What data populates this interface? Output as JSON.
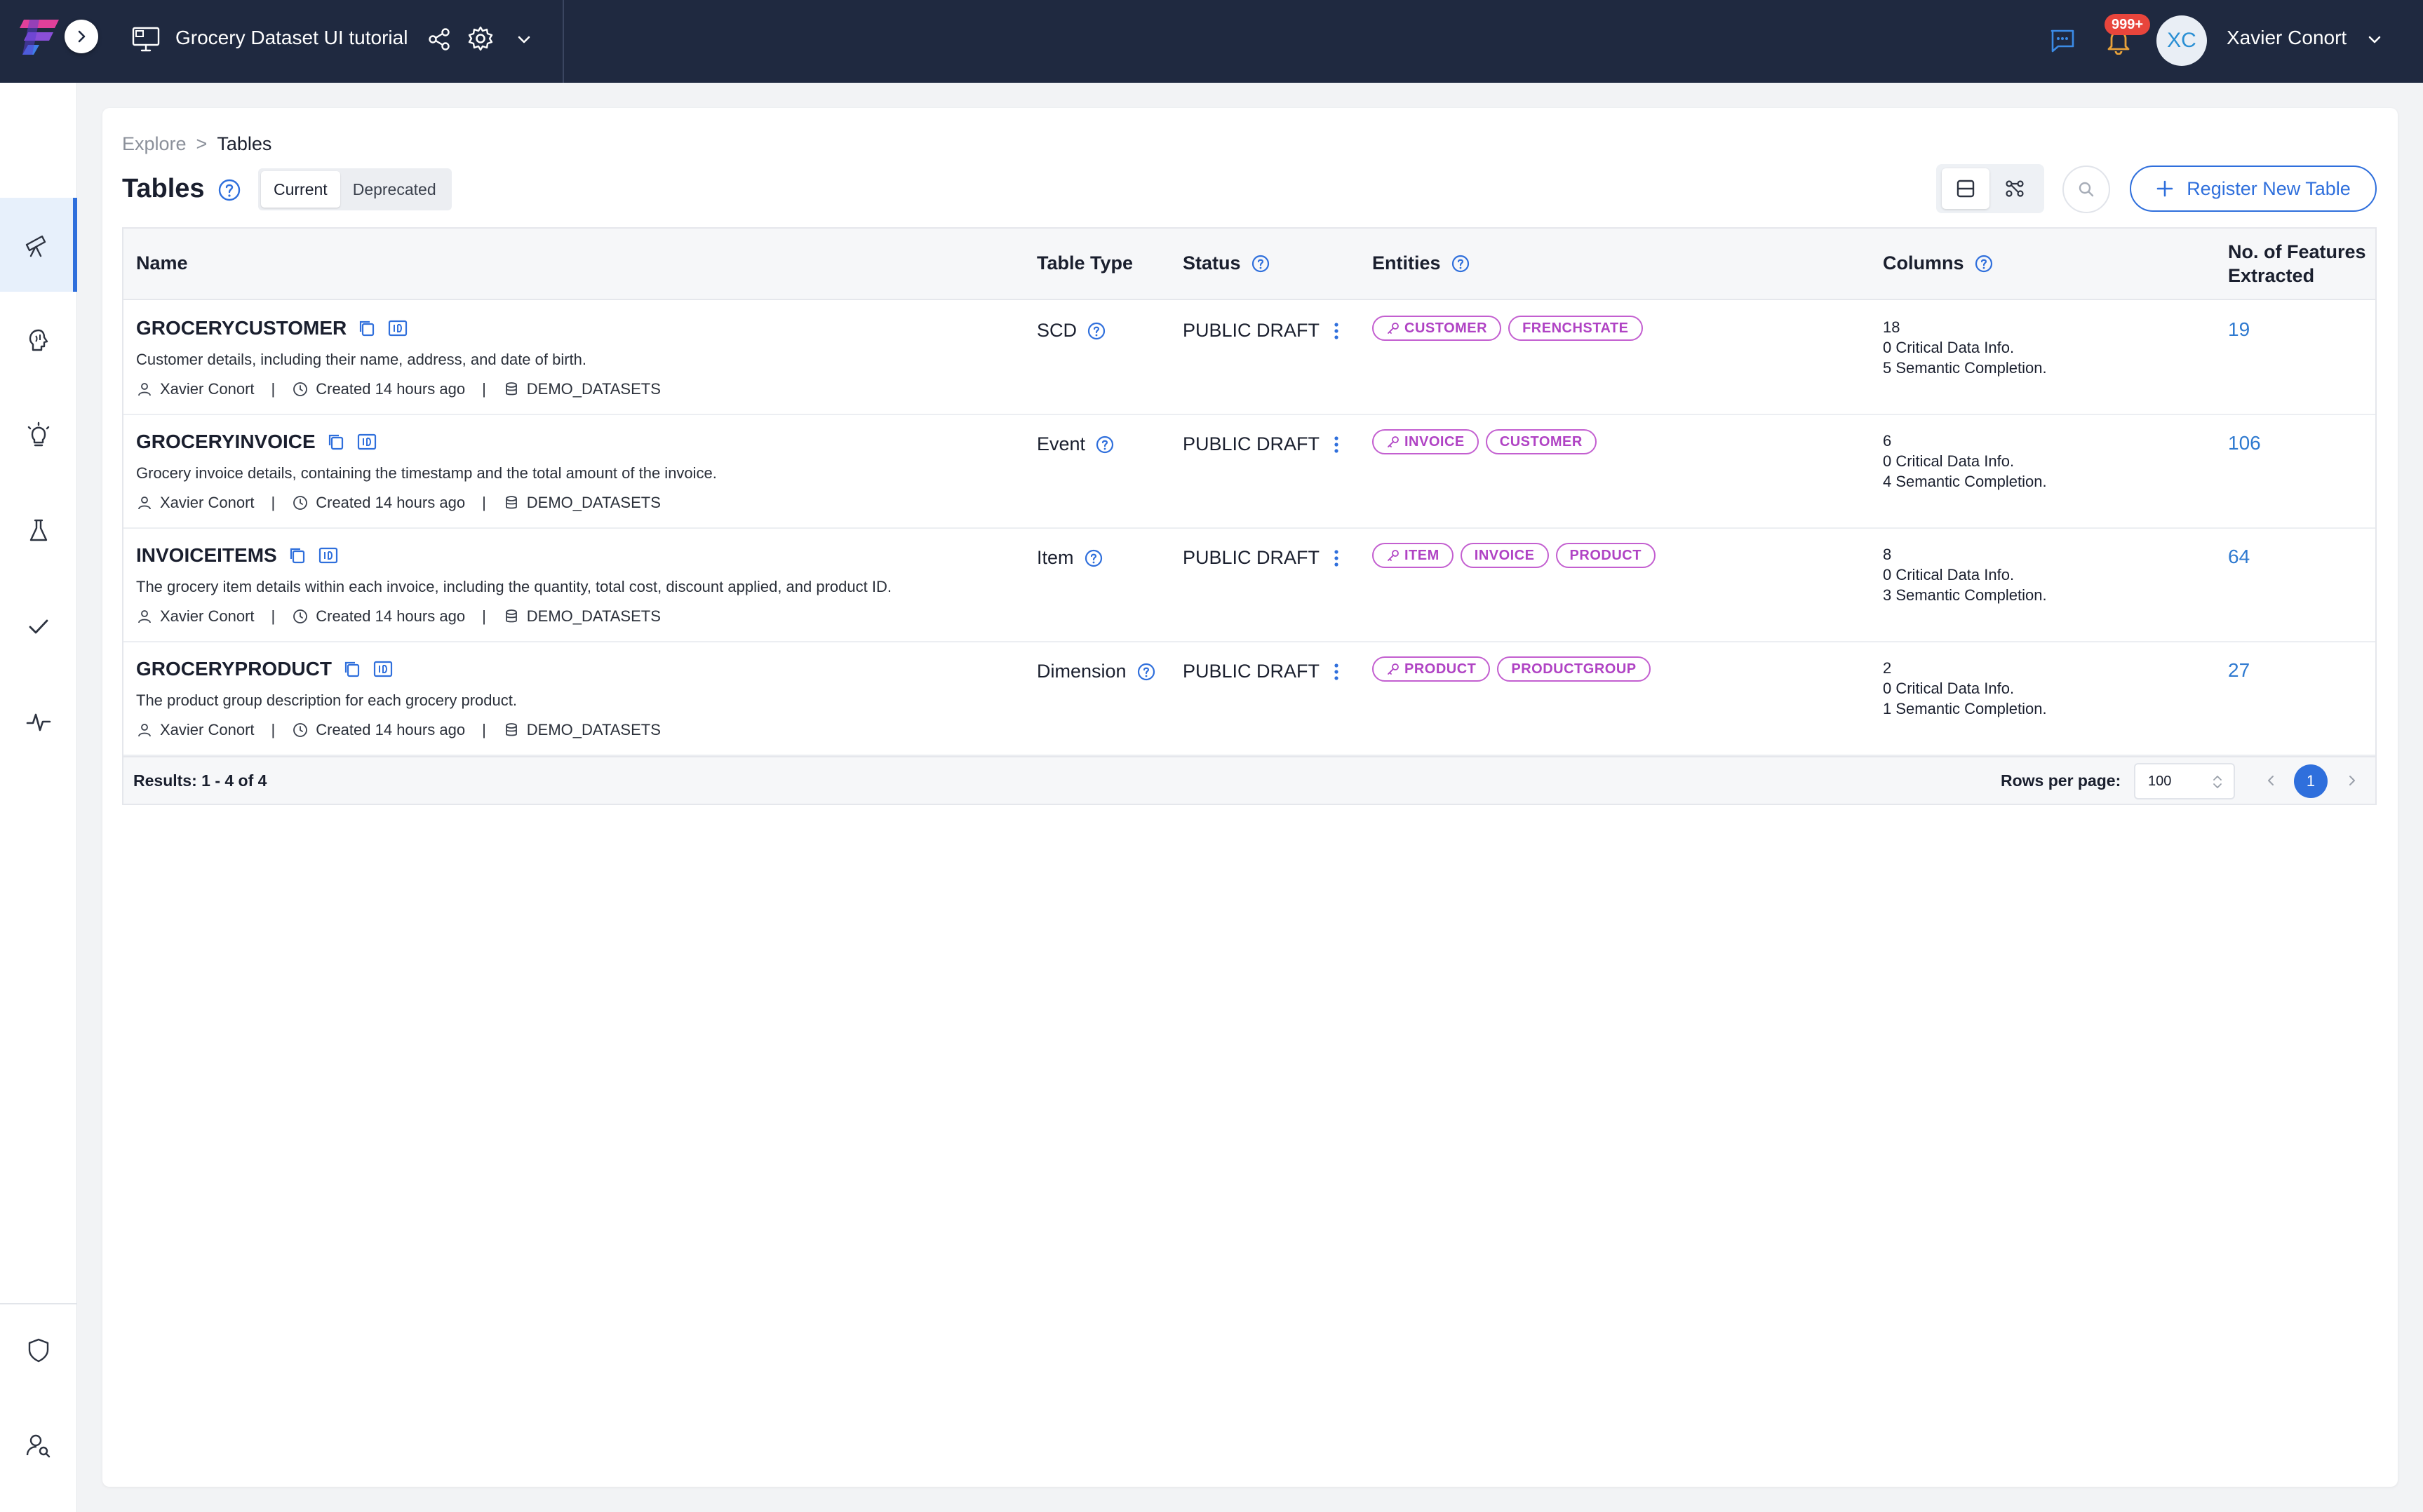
{
  "header": {
    "workspace_title": "Grocery Dataset UI tutorial",
    "notification_count": "999+",
    "user_initials": "XC",
    "user_name": "Xavier Conort"
  },
  "breadcrumb": {
    "root": "Explore",
    "separator": ">",
    "current": "Tables"
  },
  "page": {
    "title": "Tables",
    "tabs": [
      "Current",
      "Deprecated"
    ],
    "selected_tab": "Current",
    "register_label": "Register New Table"
  },
  "table": {
    "headers": {
      "name": "Name",
      "type": "Table Type",
      "status": "Status",
      "entities": "Entities",
      "columns": "Columns",
      "features_1": "No. of Features",
      "features_2": "Extracted"
    },
    "rows": [
      {
        "name": "GROCERYCUSTOMER",
        "description": "Customer details, including their name, address, and date of birth.",
        "owner": "Xavier Conort",
        "created": "Created 14 hours ago",
        "source": "DEMO_DATASETS",
        "type": "SCD",
        "status": "PUBLIC DRAFT",
        "entities": [
          {
            "label": "CUSTOMER",
            "key": true
          },
          {
            "label": "FRENCHSTATE",
            "key": false
          }
        ],
        "columns_count": "18",
        "critical": "0 Critical Data Info.",
        "semantic": "5 Semantic Completion.",
        "features": "19"
      },
      {
        "name": "GROCERYINVOICE",
        "description": "Grocery invoice details, containing the timestamp and the total amount of the invoice.",
        "owner": "Xavier Conort",
        "created": "Created 14 hours ago",
        "source": "DEMO_DATASETS",
        "type": "Event",
        "status": "PUBLIC DRAFT",
        "entities": [
          {
            "label": "INVOICE",
            "key": true
          },
          {
            "label": "CUSTOMER",
            "key": false
          }
        ],
        "columns_count": "6",
        "critical": "0 Critical Data Info.",
        "semantic": "4 Semantic Completion.",
        "features": "106"
      },
      {
        "name": "INVOICEITEMS",
        "description": "The grocery item details within each invoice, including the quantity, total cost, discount applied, and product ID.",
        "owner": "Xavier Conort",
        "created": "Created 14 hours ago",
        "source": "DEMO_DATASETS",
        "type": "Item",
        "status": "PUBLIC DRAFT",
        "entities": [
          {
            "label": "ITEM",
            "key": true
          },
          {
            "label": "INVOICE",
            "key": false
          },
          {
            "label": "PRODUCT",
            "key": false
          }
        ],
        "columns_count": "8",
        "critical": "0 Critical Data Info.",
        "semantic": "3 Semantic Completion.",
        "features": "64"
      },
      {
        "name": "GROCERYPRODUCT",
        "description": "The product group description for each grocery product.",
        "owner": "Xavier Conort",
        "created": "Created 14 hours ago",
        "source": "DEMO_DATASETS",
        "type": "Dimension",
        "status": "PUBLIC DRAFT",
        "entities": [
          {
            "label": "PRODUCT",
            "key": true
          },
          {
            "label": "PRODUCTGROUP",
            "key": false
          }
        ],
        "columns_count": "2",
        "critical": "0 Critical Data Info.",
        "semantic": "1 Semantic Completion.",
        "features": "27"
      }
    ],
    "footer": {
      "results": "Results: 1 - 4 of 4",
      "rows_per_page_label": "Rows per page:",
      "rows_per_page_value": "100",
      "current_page": "1"
    }
  },
  "icons": {
    "sidebar": [
      "explore-telescope-icon",
      "brain-icon",
      "lightbulb-icon",
      "flask-icon",
      "check-icon",
      "activity-icon",
      "shield-icon",
      "user-search-icon"
    ]
  },
  "colors": {
    "topbar": "#1f2940",
    "accent": "#2f6fdc",
    "entity_chip": "#b043c4",
    "feature_link": "#2f7ad0",
    "notification": "#e8453c"
  }
}
